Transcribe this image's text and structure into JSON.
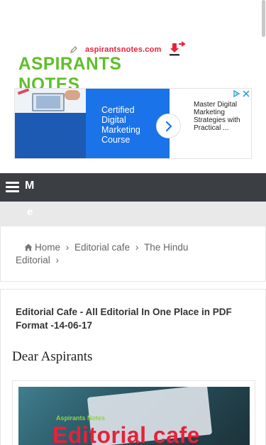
{
  "logo": {
    "site_url": "aspirantsnotes.com",
    "brand": "ASPIRANTS NOTES"
  },
  "ad": {
    "cta_text": "Certified Digital Marketing Course",
    "side_text": "Master Digital Marketing Strategies with Practical ...",
    "icons": [
      "ad-choices-icon",
      "close-icon",
      "arrow-right-icon"
    ]
  },
  "nav": {
    "menu_label_line1": "M",
    "menu_label_line2": "e"
  },
  "breadcrumb": {
    "items": [
      "Home",
      "Editorial cafe",
      "The Hindu",
      "Editorial"
    ]
  },
  "article": {
    "title": "Editorial Cafe - All Editorial In One Place in PDF Format -14-06-17",
    "greeting": "Dear Aspirants",
    "featured_watermark": "Aspirants Notes",
    "featured_overlay": "Editorial cafe"
  },
  "colors": {
    "brand_green": "#5fbf2a",
    "brand_red": "#e8213a",
    "nav_bg": "#3b3f44",
    "ad_blue": "#1a73e8"
  }
}
